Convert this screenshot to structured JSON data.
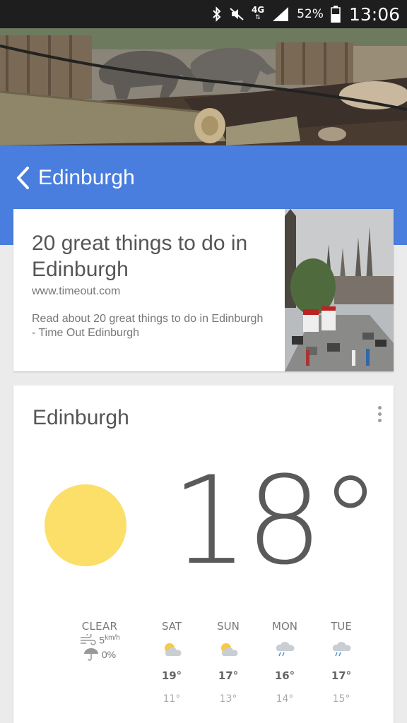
{
  "status_bar": {
    "network": "4G",
    "battery": "52%",
    "time": "13:06"
  },
  "header": {
    "title": "Edinburgh",
    "accent_color": "#4a7ede"
  },
  "article": {
    "title": "20 great things to do in Edinburgh",
    "url": "www.timeout.com",
    "description": "Read about 20 great things to do in Edinburgh - Time Out Edinburgh"
  },
  "weather": {
    "city": "Edinburgh",
    "temperature": "18°",
    "condition": "CLEAR",
    "wind_value": "5",
    "wind_unit": "km/h",
    "precipitation": "0%",
    "icon": "sun-icon",
    "sun_color": "#fbdf68",
    "forecast": [
      {
        "day": "SAT",
        "high": "19°",
        "low": "11°",
        "icon": "partly-cloudy-icon"
      },
      {
        "day": "SUN",
        "high": "17°",
        "low": "13°",
        "icon": "partly-cloudy-icon"
      },
      {
        "day": "MON",
        "high": "16°",
        "low": "14°",
        "icon": "rain-icon"
      },
      {
        "day": "TUE",
        "high": "17°",
        "low": "15°",
        "icon": "rain-icon"
      }
    ]
  }
}
